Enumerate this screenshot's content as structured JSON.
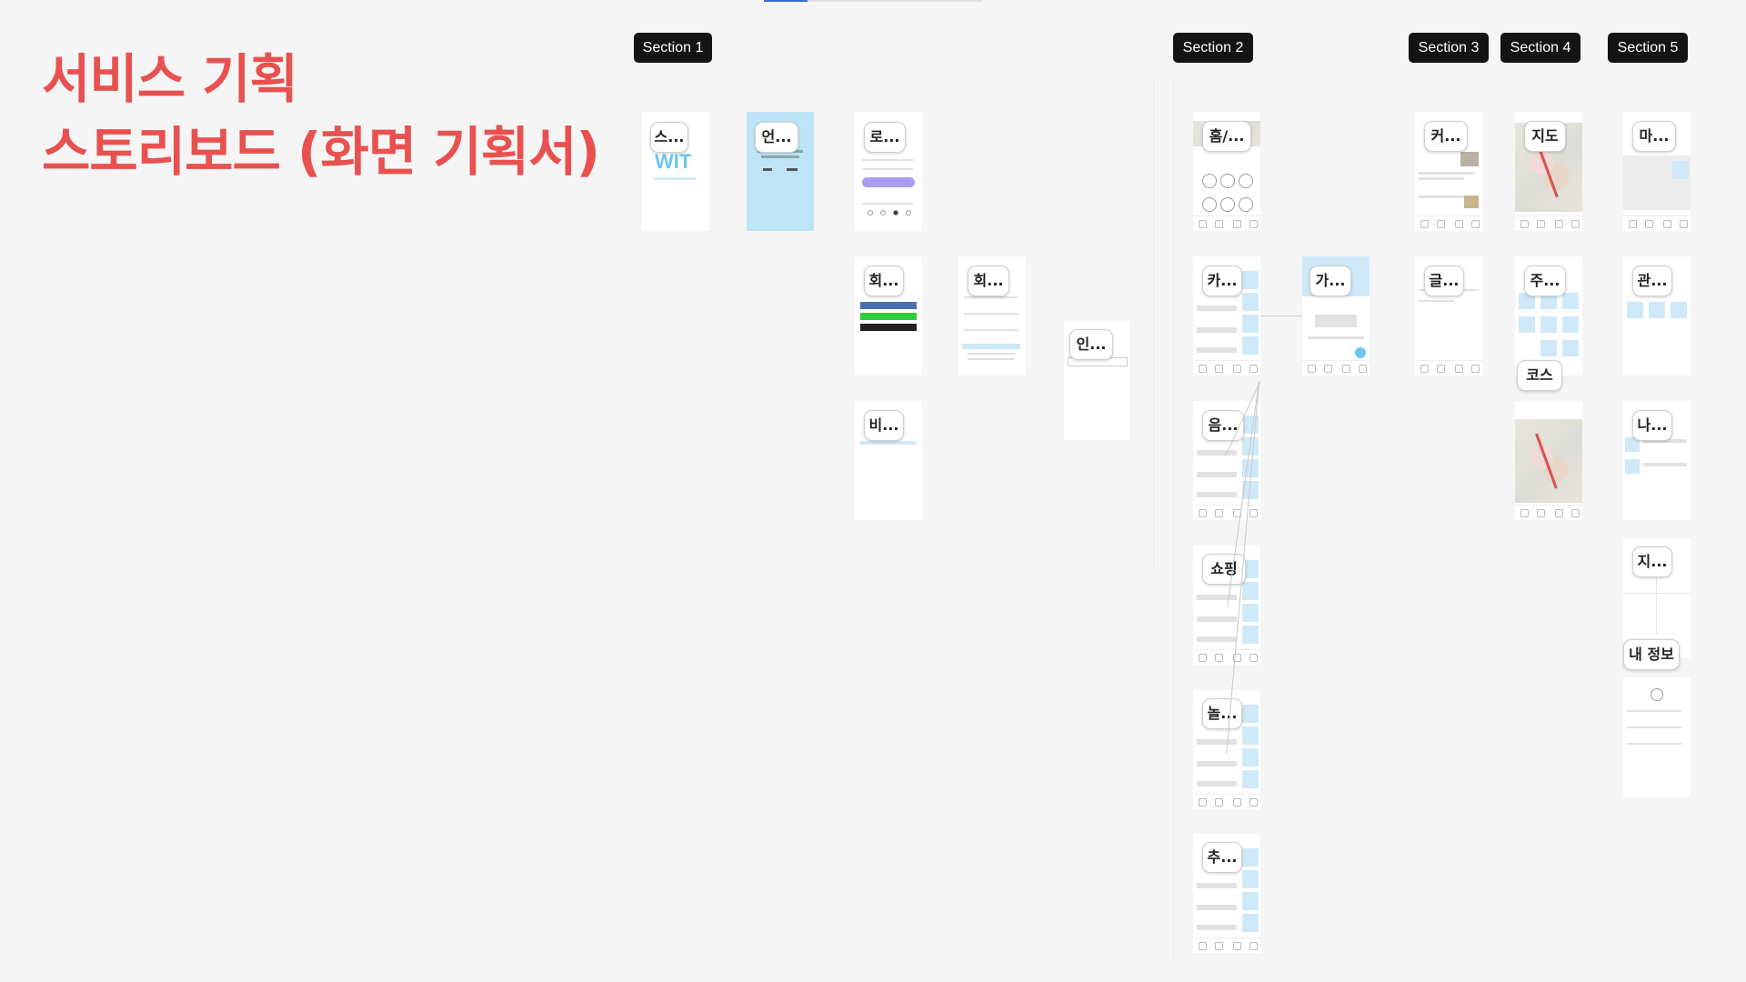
{
  "canvas": {
    "title_line1": "서비스 기획",
    "title_line2": "스토리보드 (화면 기획서)"
  },
  "sections": [
    {
      "label": "Section 1"
    },
    {
      "label": "Section 2"
    },
    {
      "label": "Section 3"
    },
    {
      "label": "Section 4"
    },
    {
      "label": "Section 5"
    }
  ],
  "screens": {
    "s1": [
      "스...",
      "언...",
      "로...",
      "회...",
      "회...",
      "인...",
      "비..."
    ],
    "s2": [
      "홈/...",
      "카...",
      "가...",
      "음...",
      "쇼핑",
      "놀...",
      "추..."
    ],
    "s3": [
      "커...",
      "글..."
    ],
    "s4": [
      "지도",
      "주...",
      "코스"
    ],
    "s5": [
      "마...",
      "관...",
      "나...",
      "지...",
      "내 정보"
    ]
  },
  "logo_text": "WIT",
  "colors": {
    "title": "#e8514f",
    "section_label_bg": "#141414",
    "screen_blue": "#bfe4f7"
  }
}
